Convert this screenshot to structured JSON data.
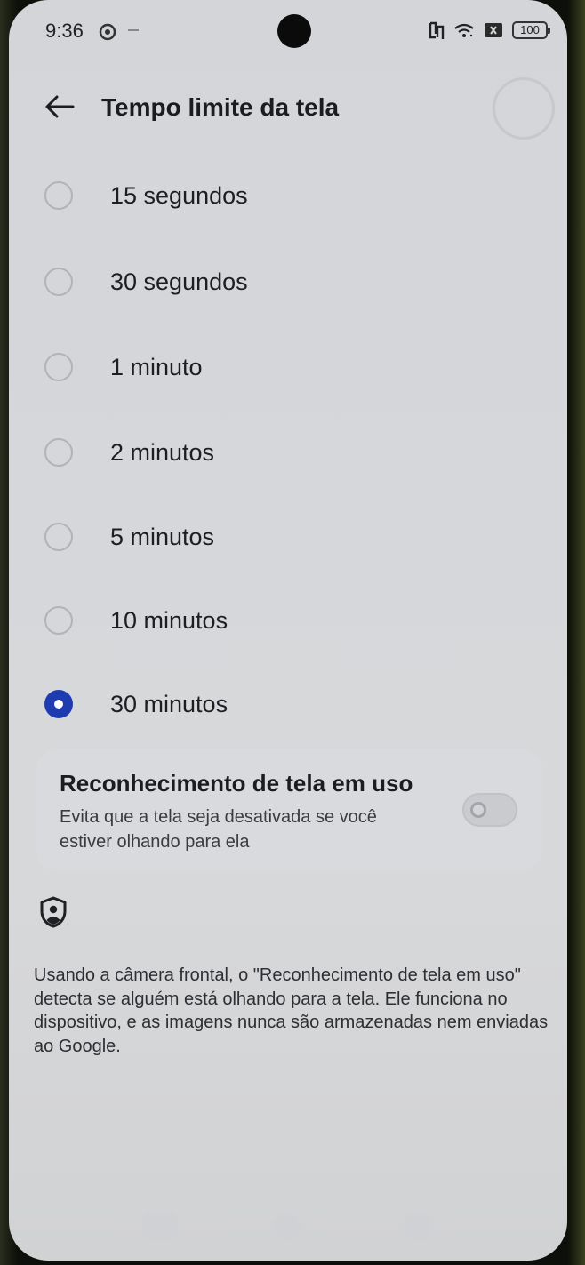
{
  "status_bar": {
    "time": "9:36",
    "battery": "100"
  },
  "header": {
    "title": "Tempo limite da tela"
  },
  "options": [
    {
      "label": "15 segundos",
      "selected": false
    },
    {
      "label": "30 segundos",
      "selected": false
    },
    {
      "label": "1 minuto",
      "selected": false
    },
    {
      "label": "2 minutos",
      "selected": false
    },
    {
      "label": "5 minutos",
      "selected": false
    },
    {
      "label": "10 minutos",
      "selected": false
    },
    {
      "label": "30 minutos",
      "selected": true
    }
  ],
  "screen_attention": {
    "title": "Reconhecimento de tela em uso",
    "description": "Evita que a tela seja desativada se você estiver olhando para ela",
    "enabled": false
  },
  "info": {
    "text": "Usando a câmera frontal, o \"Reconhecimento de tela em uso\" detecta se alguém está olhando para a tela. Ele funciona no dispositivo, e as imagens nunca são armazenadas nem enviadas ao Google."
  },
  "colors": {
    "accent": "#1f3bb0",
    "background": "#d4d6d9",
    "card": "#d8dadd"
  }
}
